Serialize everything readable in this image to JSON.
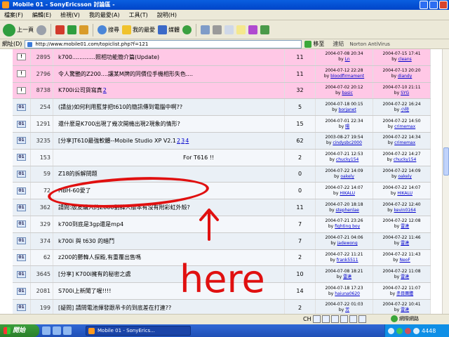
{
  "window": {
    "title": "Mobile 01 - SonyEricsson 討論區 -"
  },
  "menu": [
    "檔案(F)",
    "編輯(E)",
    "檢視(V)",
    "我的最愛(A)",
    "工具(T)",
    "說明(H)"
  ],
  "toolbar": {
    "back": "上一頁",
    "search": "搜尋",
    "favorites": "我的最愛",
    "media": "媒體"
  },
  "address": {
    "label": "網址(D)",
    "url": "http://www.mobile01.com/topiclist.php?f=121",
    "go": "移至",
    "links": "連結",
    "norton": "Norton AntiVirus"
  },
  "topics": [
    {
      "num": "2895",
      "title": "k700.............照相功能簡介篇(Update)",
      "replies": "11",
      "created": "2004-07-08 20:34",
      "creator": "Ln",
      "last": "2004-07-15 17:41",
      "last_by": "cleans",
      "pink": true,
      "hot": true
    },
    {
      "num": "2796",
      "title": "令人驚艷的Z200....讓某M牌的同價位手機相形失色....",
      "replies": "11",
      "created": "2004-07-12 22:28",
      "creator": "bloodfirmament",
      "last": "2004-07-13 20:20",
      "last_by": "diandy",
      "pink": true,
      "hot": true
    },
    {
      "num": "8738",
      "title": "K700i公司貨寫真",
      "pages": [
        "2"
      ],
      "replies": "32",
      "created": "2004-07-02 20:12",
      "creator": "basic",
      "last": "2004-07-10 21:11",
      "last_by": "SYG",
      "pink": true,
      "hot": true
    },
    {
      "num": "254",
      "title": "(請益)如何利用藍芽把t610的簡訊傳到電腦中啊??",
      "replies": "5",
      "created": "2004-07-18 00:15",
      "creator": "borjanet",
      "last": "2004-07-22 16:24",
      "last_by": "小陸"
    },
    {
      "num": "1291",
      "title": "還什麼是K700出現了幾次開機出現2現象的情形?",
      "replies": "15",
      "created": "2004-07-01 22:34",
      "creator": "陽",
      "last": "2004-07-22 14:50",
      "last_by": "crimemax"
    },
    {
      "num": "3235",
      "title": "[分享]T610最強軟體--Mobile Studio XP V2.1",
      "pages": [
        "2",
        "3",
        "4"
      ],
      "replies": "62",
      "created": "2003-08-27 19:54",
      "creator": "cindysbc2000",
      "last": "2004-07-22 14:34",
      "last_by": "crimemax"
    },
    {
      "num": "153",
      "title": "",
      "tail": "For T616 !!",
      "replies": "2",
      "created": "2004-07-21 12:53",
      "creator": "chucky154",
      "last": "2004-07-22 14:27",
      "last_by": "chucky154"
    },
    {
      "num": "59",
      "title": "Z18的拆解問題",
      "replies": "0",
      "created": "2004-07-22 14:09",
      "creator": "oakely",
      "last": "2004-07-22 14:09",
      "last_by": "oakely"
    },
    {
      "num": "72",
      "title": "HBH-60愛了",
      "replies": "0",
      "created": "2004-07-22 14:07",
      "creator": "HIKALU",
      "last": "2004-07-22 14:07",
      "last_by": "HIKALU"
    },
    {
      "num": "362",
      "title": "請問:版友購入的Z600劉韓人版本有沒有附彩虹外殼?",
      "replies": "11",
      "created": "2004-07-20 18:18",
      "creator": "stephenlae",
      "last": "2004-07-22 12:40",
      "last_by": "kevin0164"
    },
    {
      "num": "329",
      "title": "k700到底是3gp還是mp4",
      "replies": "7",
      "created": "2004-07-21 23:26",
      "creator": "fighting boy",
      "last": "2004-07-22 12:08",
      "last_by": "雷達"
    },
    {
      "num": "374",
      "title": "k700i 與 t630 的暗鬥",
      "replies": "7",
      "created": "2004-07-21 04:06",
      "creator": "jadewong",
      "last": "2004-07-22 11:46",
      "last_by": "雷達"
    },
    {
      "num": "62",
      "title": "z200的鬱韓人探殿,有重覆出售嗎",
      "replies": "2",
      "created": "2004-07-22 11:21",
      "creator": "frank5511",
      "last": "2004-07-22 11:43",
      "last_by": "NeoF"
    },
    {
      "num": "3645",
      "title": "[分享] K700i擁有的秘密之處",
      "replies": "10",
      "created": "2004-07-08 18:21",
      "creator": "雷達",
      "last": "2004-07-22 11:08",
      "last_by": "雷達"
    },
    {
      "num": "2081",
      "title": "S700i上新聞了喔!!!!",
      "replies": "14",
      "created": "2004-07-18 17:23",
      "creator": "haiuna0620",
      "last": "2004-07-22 11:07",
      "last_by": "赤目團體"
    },
    {
      "num": "199",
      "title": "[疑問] 請問電池揮發跟吊卡的到底差在打連??",
      "replies": "2",
      "created": "2004-07-22 01:03",
      "creator": "芳",
      "last": "2004-07-22 10:41",
      "last_by": "雷達"
    }
  ],
  "labels": {
    "by": "by"
  },
  "annotation": {
    "text": "here",
    "color": "#E01010"
  },
  "statusbar": {
    "zone": "網際網路",
    "lang": "CH"
  },
  "taskbar": {
    "start": "開始",
    "window": "Mobile 01 - SonyErics...",
    "tray": "4448"
  }
}
